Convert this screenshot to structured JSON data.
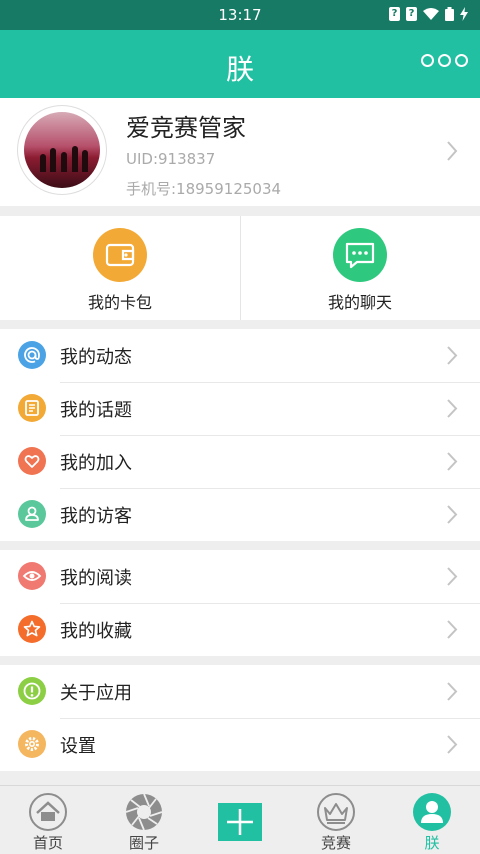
{
  "status": {
    "time": "13:17"
  },
  "header": {
    "title": "朕"
  },
  "profile": {
    "name": "爱竞赛管家",
    "uid": "UID:913837",
    "phone": "手机号:18959125034"
  },
  "quick_actions": [
    {
      "label": "我的卡包",
      "icon": "wallet-icon",
      "color": "#f3a936"
    },
    {
      "label": "我的聊天",
      "icon": "chat-icon",
      "color": "#2ec97e"
    }
  ],
  "menu_groups": [
    [
      {
        "label": "我的动态",
        "icon": "at-icon",
        "color": "#4ba3e6"
      },
      {
        "label": "我的话题",
        "icon": "note-icon",
        "color": "#f3a936"
      },
      {
        "label": "我的加入",
        "icon": "heart-icon",
        "color": "#f07352"
      },
      {
        "label": "我的访客",
        "icon": "user-icon",
        "color": "#5bc89b"
      }
    ],
    [
      {
        "label": "我的阅读",
        "icon": "eye-icon",
        "color": "#f07a72"
      },
      {
        "label": "我的收藏",
        "icon": "star-icon",
        "color": "#f56d2a"
      }
    ],
    [
      {
        "label": "关于应用",
        "icon": "info-icon",
        "color": "#8ccf45"
      },
      {
        "label": "设置",
        "icon": "gear-icon",
        "color": "#f5b660"
      }
    ]
  ],
  "tabs": [
    {
      "label": "首页",
      "icon": "home-icon"
    },
    {
      "label": "圈子",
      "icon": "aperture-icon"
    },
    {
      "label": "",
      "icon": "plus-icon"
    },
    {
      "label": "竞赛",
      "icon": "crown-icon"
    },
    {
      "label": "朕",
      "icon": "profile-icon",
      "active": true
    }
  ]
}
